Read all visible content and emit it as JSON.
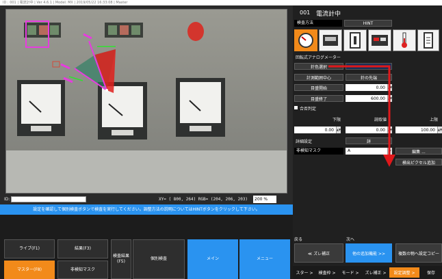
{
  "titlebar": {
    "text": "ID : 001 | 電流計中 | Ver 4.6.1 | Model: MX | 2019/05/22 16:33:08 | Master"
  },
  "camera": {
    "coords": "XY= ( 800,  264) RGB= (204, 206, 203)",
    "zoom": "200 %",
    "id_label": "ID:",
    "id_value": ""
  },
  "message": "設定を確認して個別検査ボタンで検査を実行してください。調整方法の説明についてはHINTボタンをクリックして下さい。",
  "tiles": {
    "live": "ライブ(F1)",
    "result": "結果(F3)",
    "inspect_result": "検査結果(F5)",
    "individual": "個別検査",
    "main": "メイン",
    "menu": "メニュー",
    "master": "マスター(F8)",
    "nodetect": "非検知マスク"
  },
  "right": {
    "id": "001",
    "name": "電流計中",
    "inspect_method_label": "検査方法",
    "hint": "HINT",
    "meter_type": "回転式アナログメーター",
    "needle_color": "針色選択",
    "rotation_center": "計測範囲中心",
    "tip": "針の先端",
    "scale_start": "目盛開始",
    "scale_start_value": "0.00",
    "scale_end": "目盛終了",
    "scale_end_value": "600.00",
    "judgement": "合否判定",
    "lower": "下限",
    "value_col": "読取値",
    "upper": "上限",
    "lower_value": "0.00",
    "value_value": "0.00",
    "upper_value": "100.00",
    "detail": "詳細設定",
    "detail_btn": "詳",
    "mask_label": "非検知マスク",
    "mask_value": "A",
    "edit_btn": "編集 ...",
    "add_mask": "検出ピクセル追加",
    "back_label": "戻る",
    "next_label": "次へ",
    "prev_btn": "≪ ズレ補正",
    "next_btn": "他の追加機能 >>",
    "copy_btn": "複数の物へ設定コピー"
  },
  "nav": [
    "スター >",
    "検査枠 >",
    "モード >",
    "ズレ補正 >",
    "設定調整 >",
    "保存"
  ],
  "colors": {
    "accent": "#2a93f0",
    "orange": "#f28a1a",
    "arrow": "#e0181b"
  }
}
